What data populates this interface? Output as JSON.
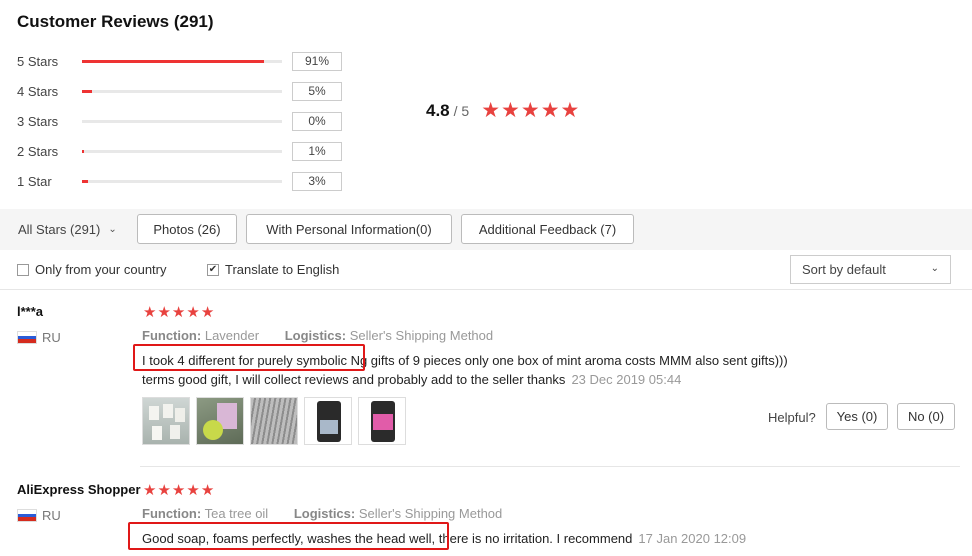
{
  "title": "Customer Reviews (291)",
  "distribution": [
    {
      "label": "5 Stars",
      "pct": "91%",
      "fill": 0.91
    },
    {
      "label": "4 Stars",
      "pct": "5%",
      "fill": 0.05
    },
    {
      "label": "3 Stars",
      "pct": "0%",
      "fill": 0.0
    },
    {
      "label": "2 Stars",
      "pct": "1%",
      "fill": 0.01
    },
    {
      "label": "1 Star",
      "pct": "3%",
      "fill": 0.03
    }
  ],
  "average": {
    "value": "4.8",
    "out_of": "/ 5",
    "stars": 5
  },
  "filters": {
    "all_stars": "All Stars (291)",
    "photos": "Photos (26)",
    "personal": "With Personal Information(0)",
    "additional": "Additional Feedback (7)"
  },
  "options": {
    "only_country": "Only from your country",
    "only_country_checked": false,
    "translate": "Translate to English",
    "translate_checked": true,
    "sort": "Sort by default"
  },
  "reviews": [
    {
      "name": "l***a",
      "country": "RU",
      "stars": 5,
      "function_label": "Function:",
      "function_value": "Lavender",
      "logistics_label": "Logistics:",
      "logistics_value": "Seller's Shipping Method",
      "text_line1": "I took 4 different for purely symbolic Ng gifts of 9 pieces only one box of mint aroma costs MMM also sent gifts)))",
      "text_line2": "terms good gift, I will collect reviews and probably add to the seller thanks",
      "date": "23 Dec 2019 05:44",
      "photos": 5,
      "helpful_label": "Helpful?",
      "yes": "Yes (0)",
      "no": "No (0)"
    },
    {
      "name": "AliExpress Shopper",
      "country": "RU",
      "stars": 5,
      "function_label": "Function:",
      "function_value": "Tea tree oil",
      "logistics_label": "Logistics:",
      "logistics_value": "Seller's Shipping Method",
      "text_line1": "Good soap, foams perfectly, washes the head well, there is no irritation. I recommend",
      "date": "17 Jan 2020 12:09"
    }
  ],
  "colors": {
    "accent": "#e8423f",
    "highlight": "#e01818",
    "bar_fill": "#ee3333"
  },
  "icons": {
    "star": "star-icon",
    "chevron": "chevron-down-icon",
    "flag": "russia-flag-icon"
  }
}
